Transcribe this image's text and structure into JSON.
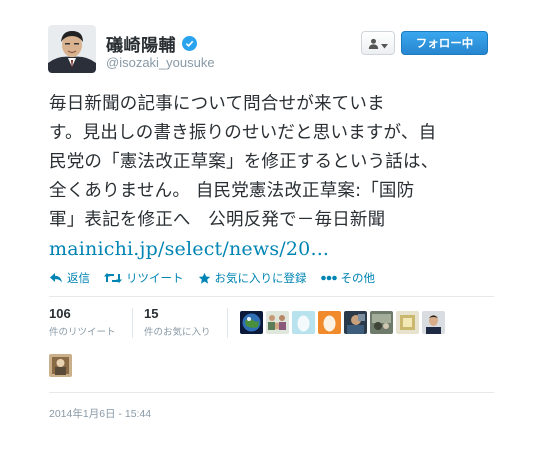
{
  "author": {
    "display_name": "礒崎陽輔",
    "handle": "@isozaki_yousuke",
    "verified": true
  },
  "buttons": {
    "follow_label": "フォロー中"
  },
  "tweet": {
    "lines": [
      "毎日新聞の記事について問合せが来ていま",
      "す。見出しの書き振りのせいだと思いますが、自",
      "民党の「憲法改正草案」を修正するという話は、",
      "全くありません。 自民党憲法改正草案:「国防",
      "軍」表記を修正へ　公明反発で－毎日新聞"
    ],
    "link": "mainichi.jp/select/news/20..."
  },
  "actions": {
    "reply": "返信",
    "retweet": "リツイート",
    "favorite": "お気に入りに登録",
    "more": "その他"
  },
  "stats": {
    "retweets_count": "106",
    "retweets_label": "件のリツイート",
    "favorites_count": "15",
    "favorites_label": "件のお気に入り"
  },
  "timestamp": "2014年1月6日 - 15:44",
  "colors": {
    "link": "#0084b4",
    "follow_button": "#2f96e0",
    "verified_badge": "#2aa3ef"
  }
}
